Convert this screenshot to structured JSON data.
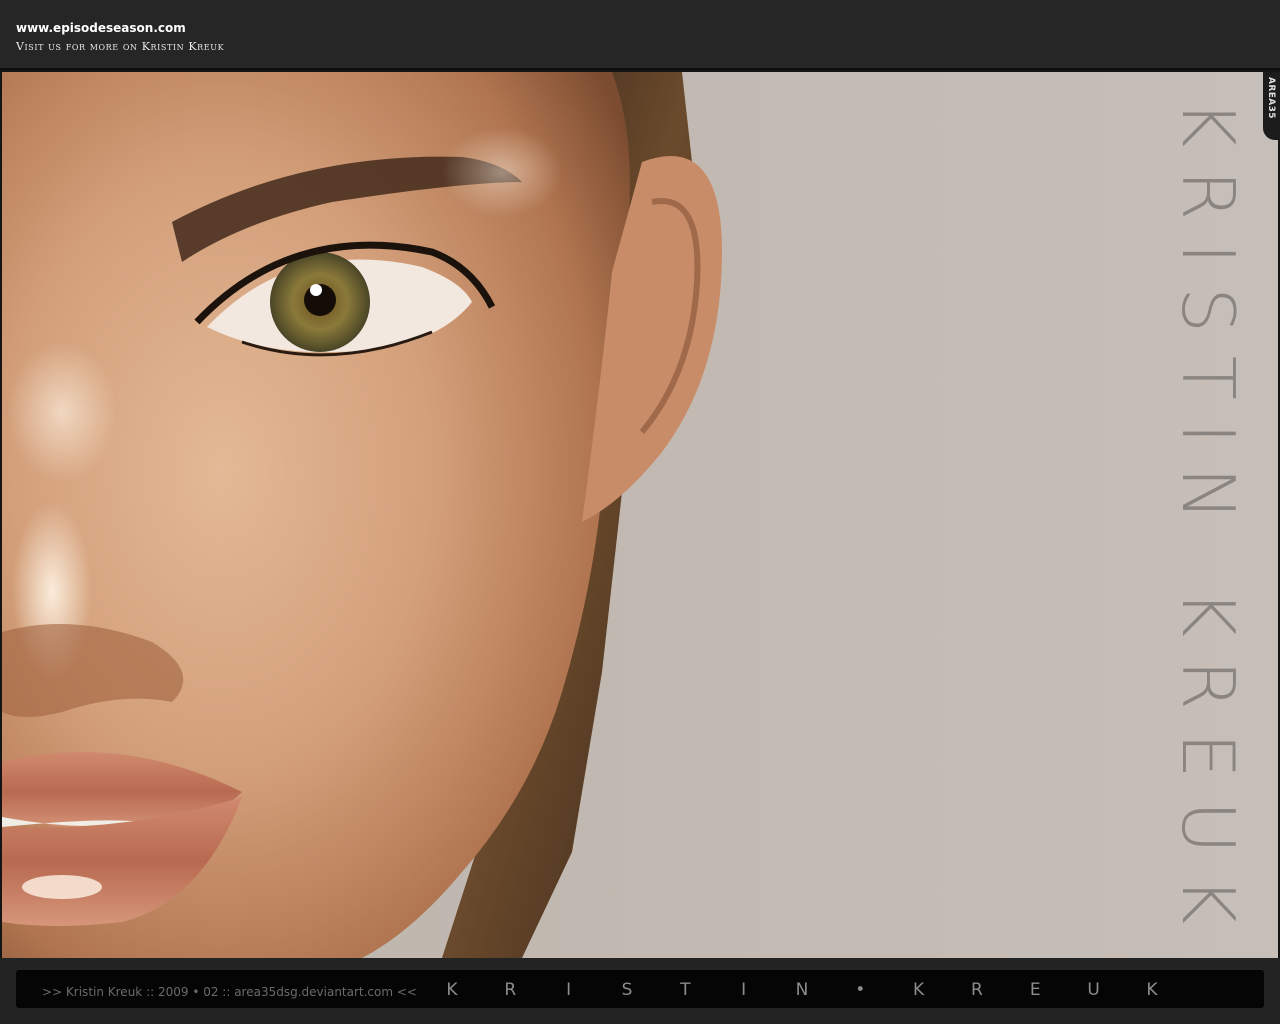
{
  "header": {
    "site_url": "www.episodeseason.com",
    "tagline": "Visit us for more on Kristin Kreuk"
  },
  "main": {
    "vertical_title": "KRISTIN KREUK",
    "corner_tab": "AREA35"
  },
  "footer": {
    "credit": ">> Kristin Kreuk :: 2009 • 02 :: area35dsg.deviantart.com <<",
    "spaced_name": "KRISTIN•KREUK"
  },
  "colors": {
    "backdrop": "#c3bbb4",
    "header_bar": "#262626",
    "footer_bar": "#232323",
    "title_gray": "#8a8581"
  }
}
